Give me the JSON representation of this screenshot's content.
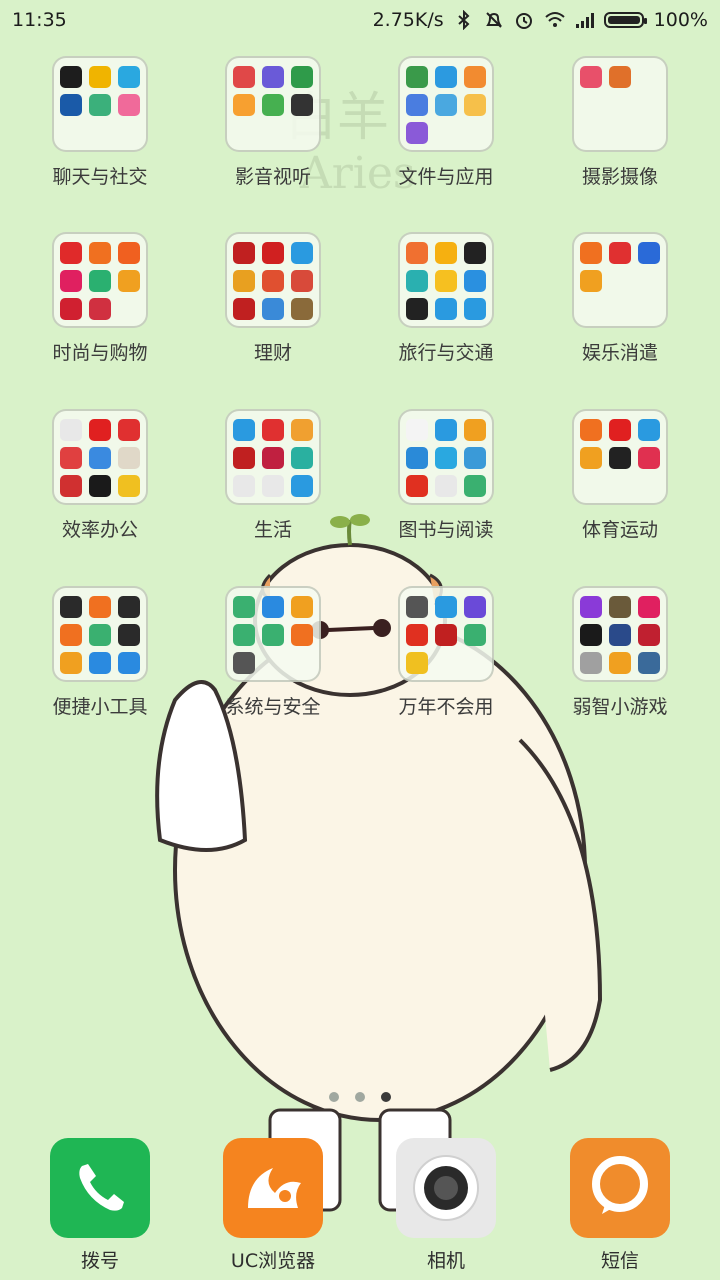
{
  "status_bar": {
    "time": "11:35",
    "speed": "2.75K/s",
    "battery": "100%",
    "icons": [
      "bluetooth-icon",
      "mute-icon",
      "alarm-icon",
      "wifi-icon",
      "signal-icon",
      "battery-icon"
    ]
  },
  "folders": [
    {
      "label": "聊天与社交",
      "colors": [
        "#1d1d1d",
        "#f0b400",
        "#2aa8e0",
        "#1a5aa8",
        "#3bb07b",
        "#f06a9a"
      ]
    },
    {
      "label": "影音视听",
      "colors": [
        "#e04848",
        "#6a5ad8",
        "#2f9b4a",
        "#f7a030",
        "#46b050",
        "#333333"
      ]
    },
    {
      "label": "文件与应用",
      "colors": [
        "#3a9a4a",
        "#2c9ae0",
        "#f28b30",
        "#4a7de0",
        "#4aa8e0",
        "#f6c04a",
        "#8a5ad8"
      ]
    },
    {
      "label": "摄影摄像",
      "colors": [
        "#e8506a",
        "#e0702a"
      ]
    },
    {
      "label": "时尚与购物",
      "colors": [
        "#e02a2a",
        "#f07020",
        "#f06020",
        "#e02060",
        "#2ab070",
        "#f0a020",
        "#d02030",
        "#d03040"
      ]
    },
    {
      "label": "理财",
      "colors": [
        "#c02020",
        "#d02020",
        "#2a9ae0",
        "#e8a020",
        "#e05030",
        "#d84a3a",
        "#c02020",
        "#3a8ad8",
        "#8a6a3a"
      ]
    },
    {
      "label": "旅行与交通",
      "colors": [
        "#f07030",
        "#f6b010",
        "#222222",
        "#2ab0b0",
        "#f6c020",
        "#2a90e0",
        "#222222",
        "#2a9ae0",
        "#2a9ae0"
      ]
    },
    {
      "label": "娱乐消遣",
      "colors": [
        "#f07020",
        "#e03030",
        "#2a6ad8",
        "#f0a020"
      ]
    },
    {
      "label": "效率办公",
      "colors": [
        "#e8e8e8",
        "#e02020",
        "#e03030",
        "#e04040",
        "#3a8ae0",
        "#e0d8c8",
        "#d03030",
        "#1a1a1a",
        "#f0c020"
      ]
    },
    {
      "label": "生活",
      "colors": [
        "#2a9ae0",
        "#e03030",
        "#f0a030",
        "#c02020",
        "#c02040",
        "#2ab0a0",
        "#e8e8e8",
        "#e8e8e8",
        "#2a9ae0"
      ]
    },
    {
      "label": "图书与阅读",
      "colors": [
        "#f4f4f4",
        "#2a9ae0",
        "#f0a020",
        "#2a8ad8",
        "#2aa8e0",
        "#3a9ad8",
        "#e03020",
        "#e8e8e8",
        "#3ab070"
      ]
    },
    {
      "label": "体育运动",
      "colors": [
        "#f07020",
        "#e02020",
        "#2a9ae0",
        "#f0a020",
        "#222222",
        "#e03050"
      ]
    },
    {
      "label": "便捷小工具",
      "colors": [
        "#2a2a2a",
        "#f07020",
        "#2a2a2a",
        "#f07020",
        "#3ab070",
        "#2a2a2a",
        "#f0a020",
        "#2a8ae0",
        "#2a8ae0"
      ]
    },
    {
      "label": "系统与安全",
      "colors": [
        "#3ab070",
        "#2a8ae0",
        "#f0a020",
        "#3ab070",
        "#3ab070",
        "#f07020",
        "#555555"
      ]
    },
    {
      "label": "万年不会用",
      "colors": [
        "#555555",
        "#2a9ae0",
        "#6a4ad8",
        "#e03020",
        "#c02020",
        "#3ab070",
        "#f0c020"
      ]
    },
    {
      "label": "弱智小游戏",
      "colors": [
        "#8a3ad8",
        "#6a5a3a",
        "#e02060",
        "#1a1a1a",
        "#2a4a8a",
        "#c02030",
        "#a0a0a0",
        "#f0a020",
        "#3a6a9a"
      ]
    }
  ],
  "page_indicator": {
    "count": 3,
    "active": 3
  },
  "dock": [
    {
      "label": "拨号",
      "color": "#1fb654"
    },
    {
      "label": "UC浏览器",
      "color": "#f5841f"
    },
    {
      "label": "相机",
      "color": "#e8e8e8"
    },
    {
      "label": "短信",
      "color": "#f08c2c"
    }
  ],
  "wallpaper": {
    "text_line1": "白羊",
    "text_line2": "Aries"
  }
}
